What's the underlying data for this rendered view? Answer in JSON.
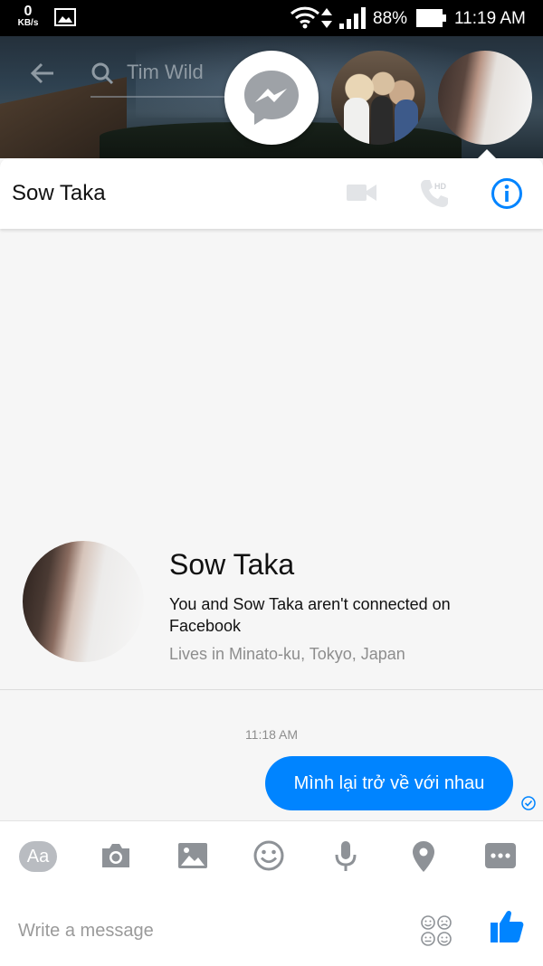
{
  "status_bar": {
    "net_speed_value": "0",
    "net_speed_unit": "KB/s",
    "battery_percent": "88%",
    "time": "11:19 AM"
  },
  "top_bar": {
    "search_text": "Tim Wild"
  },
  "chat_header": {
    "title": "Sow Taka"
  },
  "profile": {
    "name": "Sow Taka",
    "connection_text": "You and Sow Taka aren't connected on Facebook",
    "location": "Lives in Minato-ku, Tokyo, Japan"
  },
  "conversation": {
    "timestamp": "11:18 AM",
    "messages": [
      {
        "text": "Mình lại trở về với nhau",
        "from": "me"
      }
    ]
  },
  "composer": {
    "aa_label": "Aa",
    "placeholder": "Write a message"
  },
  "colors": {
    "accent": "#0084ff",
    "icon_gray": "#8e9297"
  }
}
